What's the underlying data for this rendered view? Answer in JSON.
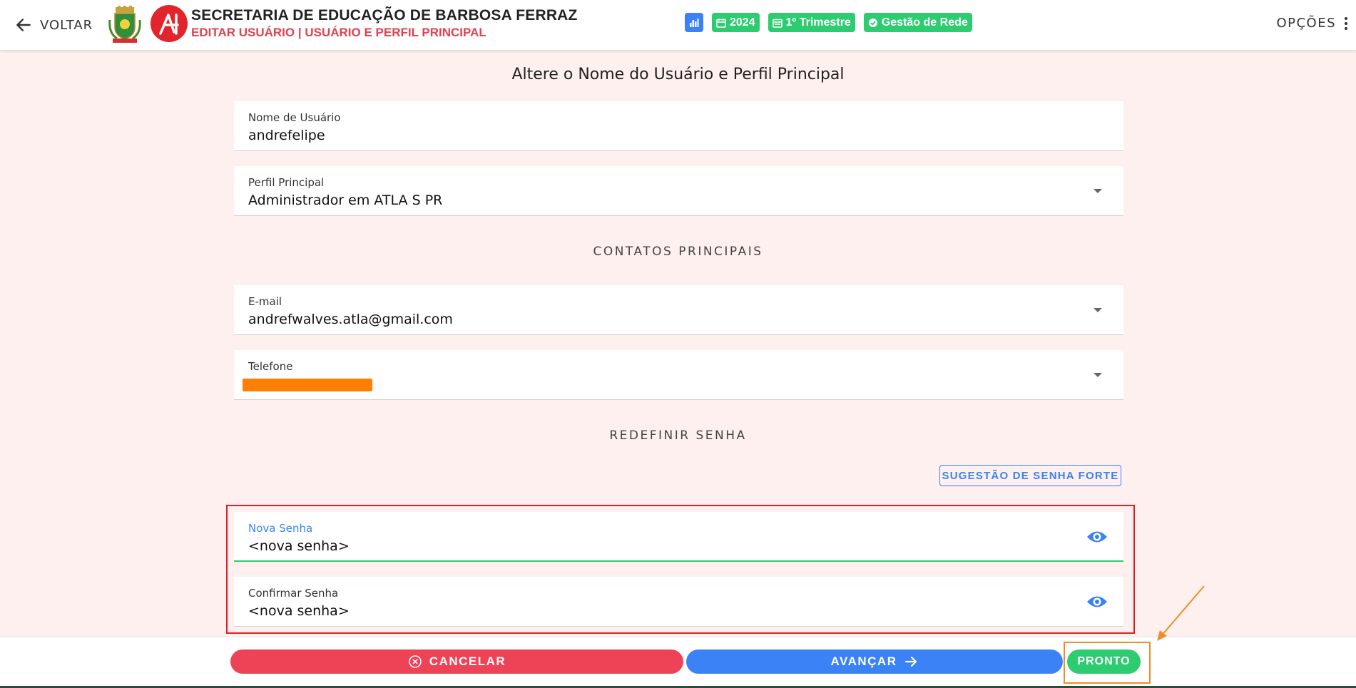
{
  "header": {
    "back_label": "VOLTAR",
    "org_title": "SECRETARIA DE EDUCAÇÃO DE BARBOSA FERRAZ",
    "page_subtitle": "EDITAR USUÁRIO | USUÁRIO E PERFIL PRINCIPAL",
    "badges": {
      "year": "2024",
      "period": "1º Trimestre",
      "module": "Gestão de Rede"
    },
    "options_label": "OPÇÕES"
  },
  "form": {
    "heading": "Altere o Nome do Usuário e Perfil Principal",
    "username": {
      "label": "Nome de Usuário",
      "value": "andrefelipe"
    },
    "main_profile": {
      "label": "Perfil Principal",
      "value": "Administrador em ATLA S PR"
    },
    "contacts_title": "CONTATOS PRINCIPAIS",
    "email": {
      "label": "E-mail",
      "value": "andrefwalves.atla@gmail.com"
    },
    "phone": {
      "label": "Telefone"
    },
    "password_title": "REDEFINIR SENHA",
    "suggest_label": "SUGESTÃO DE SENHA FORTE",
    "new_password": {
      "label": "Nova Senha",
      "value": "<nova senha>"
    },
    "confirm_password": {
      "label": "Confirmar Senha",
      "value": "<nova senha>"
    }
  },
  "footer": {
    "cancel_label": "CANCELAR",
    "next_label": "AVANÇAR",
    "done_label": "PRONTO"
  },
  "colors": {
    "accent_red": "#ee4257",
    "accent_blue": "#3b82f6",
    "accent_green": "#2ecc71",
    "page_bg": "#fdf0ee"
  }
}
